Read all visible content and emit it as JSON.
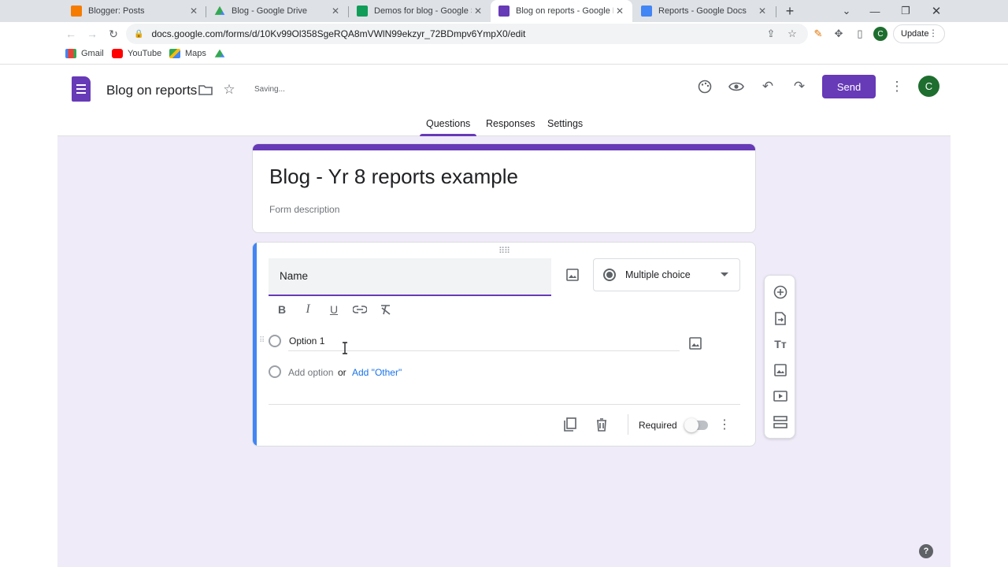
{
  "browser": {
    "tabs": [
      {
        "title": "Blogger: Posts",
        "favicon": "blogger-icon",
        "color": "#f57c00"
      },
      {
        "title": "Blog - Google Drive",
        "favicon": "google-drive-icon",
        "color": "#34a853"
      },
      {
        "title": "Demos for blog - Google She",
        "favicon": "google-sheets-icon",
        "color": "#0f9d58"
      },
      {
        "title": "Blog on reports - Google Fo",
        "favicon": "google-forms-icon",
        "color": "#673ab7"
      },
      {
        "title": "Reports - Google Docs",
        "favicon": "google-docs-icon",
        "color": "#4285f4"
      }
    ],
    "active_tab": 3,
    "url": "docs.google.com/forms/d/10Kv99Ol358SgeRQA8mVWlN99ekzyr_72BDmpv6YmpX0/edit",
    "profile_initial": "C",
    "update_label": "Update",
    "bookmarks": [
      {
        "label": "Gmail",
        "icon": "gmail-icon"
      },
      {
        "label": "YouTube",
        "icon": "youtube-icon"
      },
      {
        "label": "Maps",
        "icon": "maps-icon"
      },
      {
        "label": "",
        "icon": "google-drive-icon"
      }
    ]
  },
  "app": {
    "doc_title": "Blog on reports",
    "save_status": "Saving...",
    "send_label": "Send",
    "avatar_initial": "C",
    "accent_color": "#673ab7",
    "tabs": [
      "Questions",
      "Responses",
      "Settings"
    ],
    "active_tab": "Questions"
  },
  "form": {
    "title": "Blog - Yr 8 reports example",
    "description_placeholder": "Form description"
  },
  "question": {
    "title": "Name",
    "type": "Multiple choice",
    "options": [
      "Option 1"
    ],
    "add_option_label": "Add option",
    "or_label": "or",
    "add_other_label": "Add \"Other\"",
    "required_label": "Required",
    "required": false
  }
}
